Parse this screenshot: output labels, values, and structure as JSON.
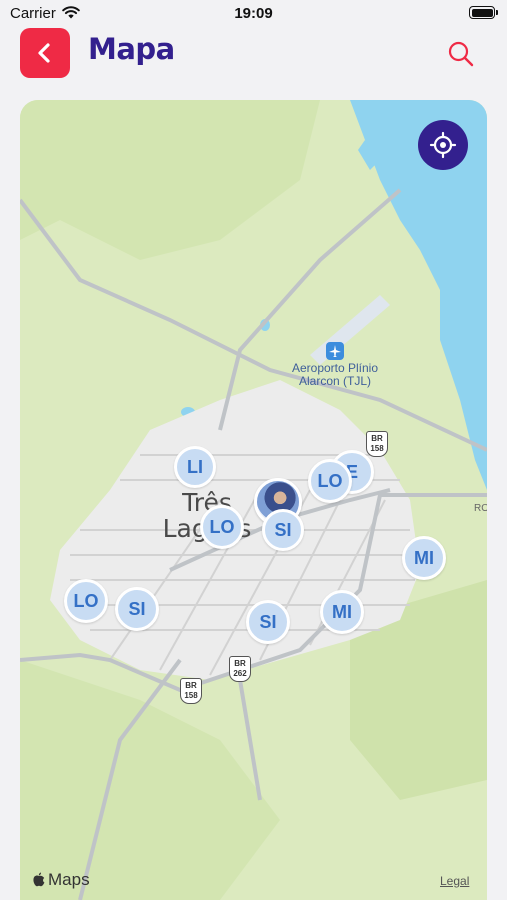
{
  "status_bar": {
    "carrier": "Carrier",
    "time": "19:09"
  },
  "header": {
    "title": "Mapa",
    "back_icon": "chevron-left-icon",
    "search_icon": "search-icon"
  },
  "colors": {
    "accent_red": "#ef2a45",
    "brand_purple": "#33208e",
    "pin_fill": "#c8dcf3",
    "pin_text": "#3470c6"
  },
  "map": {
    "city_label_line1": "Três",
    "city_label_line2": "Lagoas",
    "airport_label_line1": "Aeroporto Plínio",
    "airport_label_line2": "Alarcon (TJL)",
    "road_label_ro": "RO",
    "shields": [
      {
        "line1": "BR",
        "line2": "158"
      },
      {
        "line1": "BR",
        "line2": "262"
      },
      {
        "line1": "BR",
        "line2": "158"
      }
    ],
    "pins": [
      "E",
      "LI",
      "LO",
      "LO",
      "SI",
      "MI",
      "LO",
      "SI",
      "SI",
      "MI"
    ],
    "provider": "Maps",
    "legal": "Legal"
  }
}
